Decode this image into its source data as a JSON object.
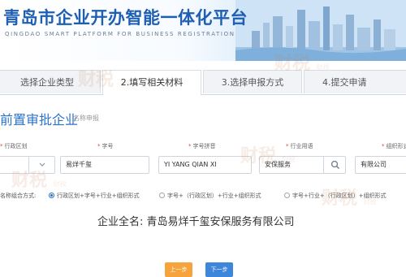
{
  "header": {
    "title": "青岛市企业开办智能一体化平台",
    "subtitle": "QINGDAO SMART PLATFORM FOR BUSINESS REGISTRATION"
  },
  "steps": [
    {
      "label": "选择企业类型",
      "active": false
    },
    {
      "label": "2.填写相关材料",
      "active": true
    },
    {
      "label": "3.选择申报方式",
      "active": false
    },
    {
      "label": "4.提交申请",
      "active": false
    }
  ],
  "section": {
    "title": "前置审批企业",
    "subtitle": "名称申报"
  },
  "fields": {
    "region": {
      "label": "行政区划",
      "required": true,
      "value": ""
    },
    "trade_name": {
      "label": "字号",
      "required": true,
      "value": "易烊千玺"
    },
    "trade_pinyin": {
      "label": "字号拼音",
      "required": true,
      "value": "YI YANG QIAN XI"
    },
    "industry": {
      "label": "行业用语",
      "required": true,
      "value": "安保服务"
    },
    "org_form": {
      "label": "组织形式",
      "required": true,
      "value": "有限公司"
    }
  },
  "composition": {
    "label": "名称组合方式:",
    "options": [
      {
        "label": "行政区划+字号+行业+组织形式",
        "checked": true
      },
      {
        "label": "字号+（行政区划）+行业+组织形式",
        "checked": false
      },
      {
        "label": "字号+行业+（行政区划）+组织形式",
        "checked": false
      }
    ]
  },
  "full_name": {
    "label": "企业全名:",
    "value": "青岛易烊千玺安保服务有限公司"
  },
  "buttons": {
    "prev": "上一步",
    "next": "下一步"
  },
  "watermark": {
    "text": "财税",
    "small": "财税"
  },
  "colors": {
    "brand_blue": "#1e5fb4",
    "accent_blue": "#2c73c8",
    "prev_button": "#f5a33a",
    "next_button": "#3d86dc",
    "required": "#e2453c"
  }
}
